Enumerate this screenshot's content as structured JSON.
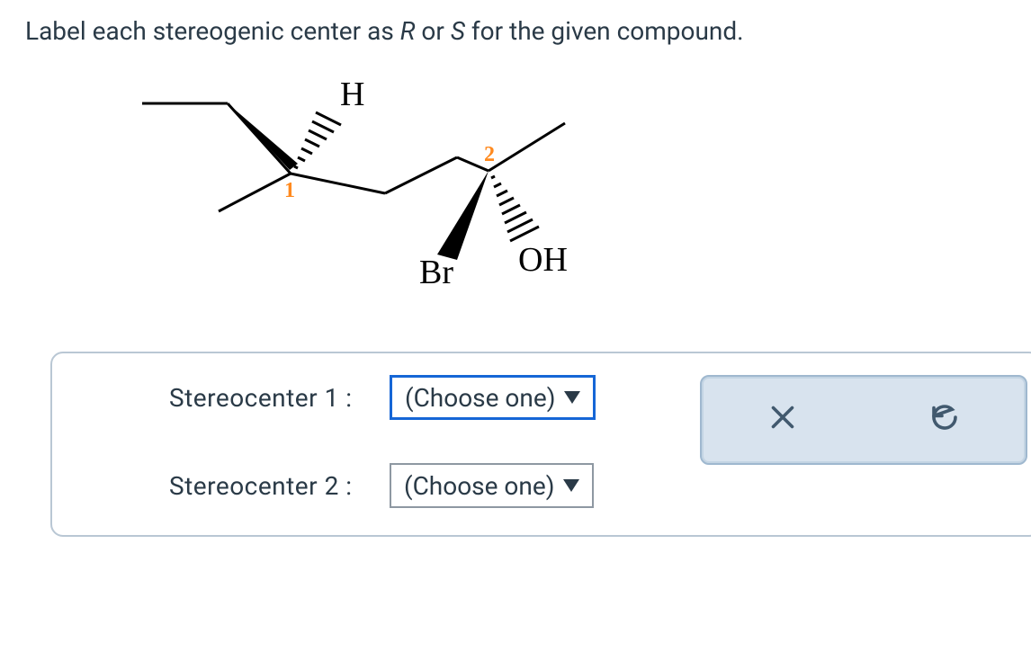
{
  "question": {
    "prefix": "Label each stereogenic center as ",
    "r": "R",
    "mid": " or ",
    "s": "S",
    "suffix": " for the given compound."
  },
  "structure": {
    "label_H": "H",
    "label_Br": "Br",
    "label_OH": "OH",
    "num1": "1",
    "num2": "2"
  },
  "answers": {
    "sc1_label": "Stereocenter  1 :",
    "sc2_label": "Stereocenter  2 :",
    "choose": "(Choose one)"
  }
}
